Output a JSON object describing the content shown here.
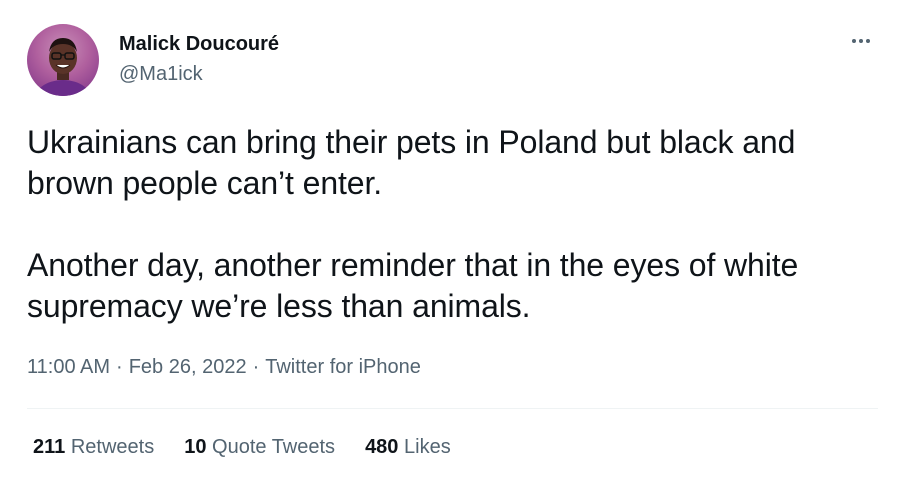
{
  "author": {
    "display_name": "Malick Doucouré",
    "handle": "@Ma1ick"
  },
  "tweet": {
    "paragraphs": [
      "Ukrainians can bring their pets in Poland but black and brown people can’t enter.",
      "Another day, another reminder that in the eyes of white supremacy we’re less than animals."
    ],
    "time": "11:00 AM",
    "separator": "·",
    "date": "Feb 26, 2022",
    "source": "Twitter for iPhone"
  },
  "stats": {
    "retweets": {
      "count": "211",
      "label": "Retweets"
    },
    "quote_tweets": {
      "count": "10",
      "label": "Quote Tweets"
    },
    "likes": {
      "count": "480",
      "label": "Likes"
    }
  },
  "icons": {
    "more": "more-horizontal-icon"
  },
  "colors": {
    "text_primary": "#0f1419",
    "text_secondary": "#536471",
    "divider": "#eff3f4",
    "avatar_bg": "#b0609e"
  }
}
